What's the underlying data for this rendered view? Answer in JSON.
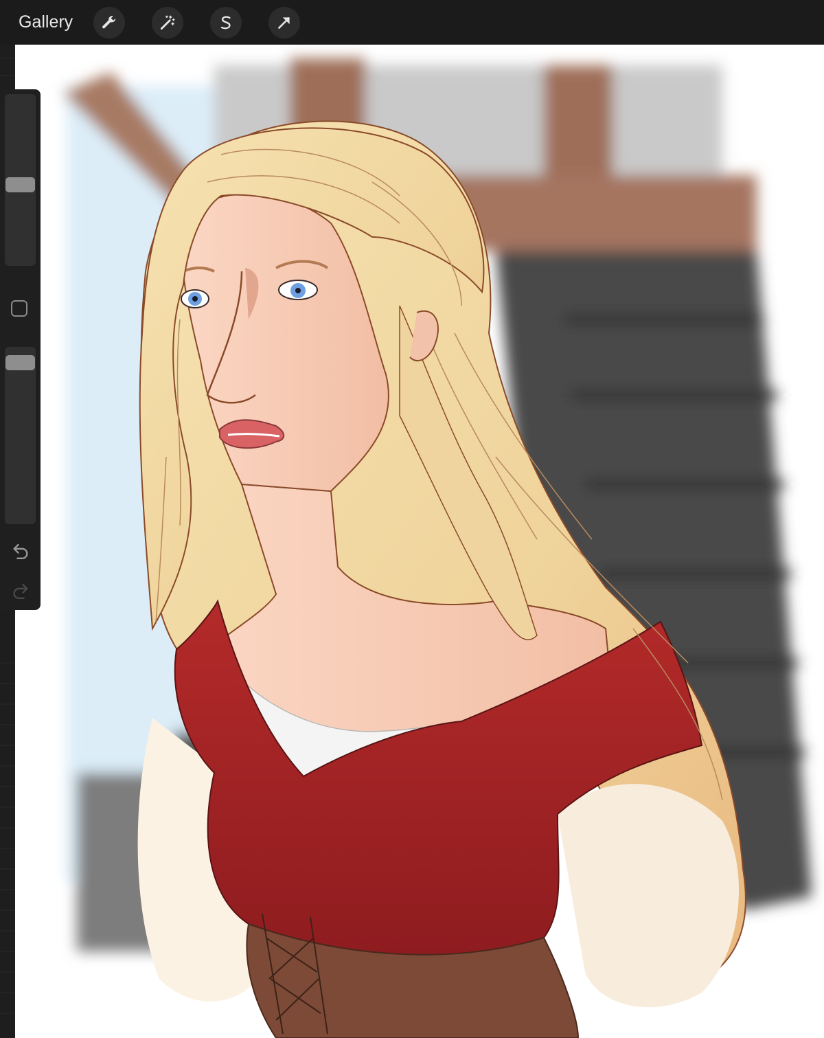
{
  "toolbar": {
    "gallery_label": "Gallery",
    "tools": [
      {
        "name": "actions",
        "icon": "wrench-icon"
      },
      {
        "name": "adjustments",
        "icon": "magic-wand-icon"
      },
      {
        "name": "selection",
        "icon": "selection-s-icon"
      },
      {
        "name": "transform",
        "icon": "arrow-cursor-icon"
      }
    ]
  },
  "sidebar": {
    "brush_size_level": 0.47,
    "opacity_level": 0.95,
    "undo_icon": "undo-icon",
    "redo_icon": "redo-icon",
    "redo_enabled": false
  },
  "colors": {
    "toolbar_bg": "#1b1b1b",
    "canvas_bg": "#ffffff",
    "hair": "#efd9a6",
    "dress_red": "#a52424",
    "skin": "#f4cbb6",
    "wall_gray": "#4a4a4a",
    "wood": "#a0705a",
    "sky": "#dceffb"
  }
}
